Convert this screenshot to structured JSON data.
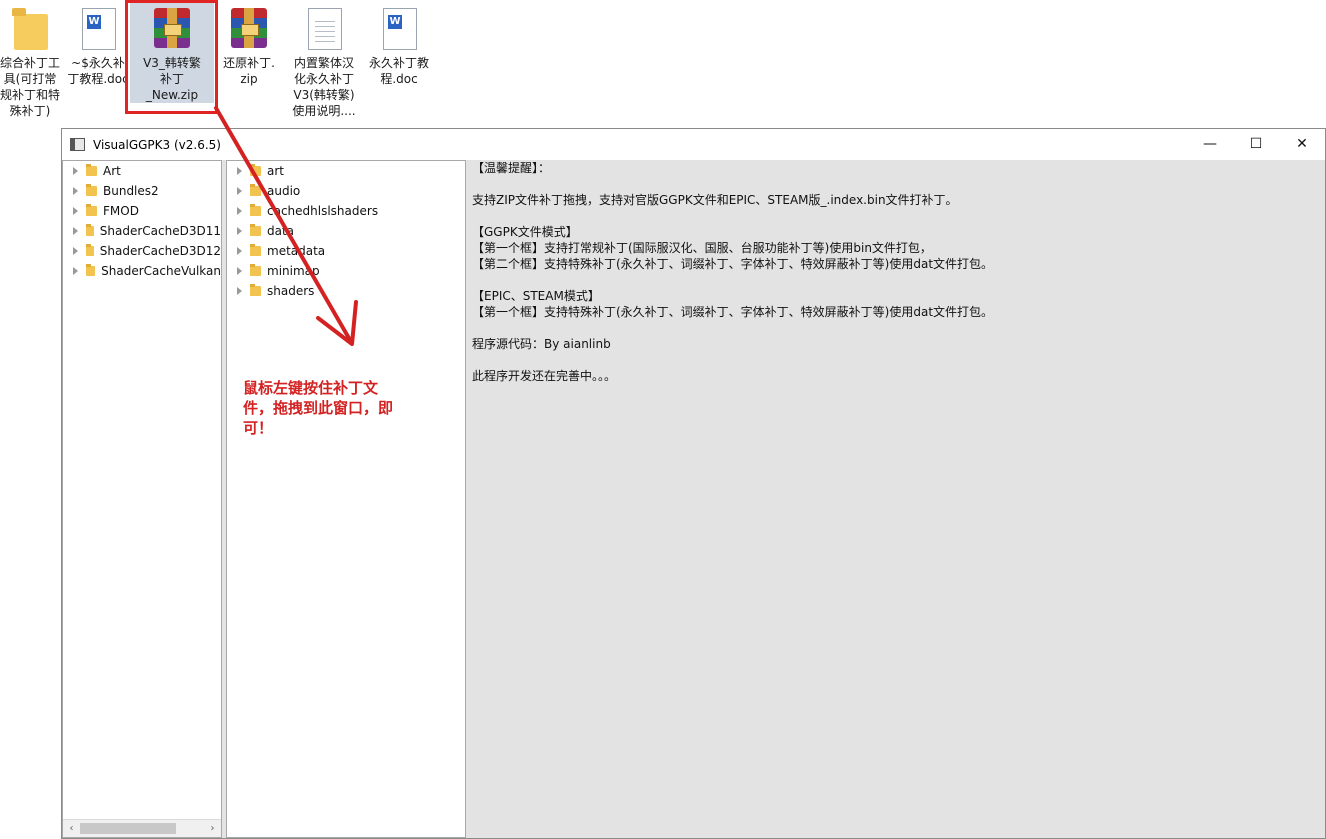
{
  "desktop": {
    "icons": [
      {
        "label": "综合补丁工\n具(可打常\n规补丁和特\n殊补丁)",
        "icon": "folder-icon"
      },
      {
        "label": "~$永久补\n丁教程.doc",
        "icon": "word-doc-icon"
      },
      {
        "label": "V3_韩转繁\n补丁\n_New.zip",
        "icon": "winrar-archive-icon",
        "selected": true
      },
      {
        "label": "还原补丁.\nzip",
        "icon": "winrar-archive-icon"
      },
      {
        "label": "内置繁体汉\n化永久补丁\nV3(韩转繁)\n使用说明....",
        "icon": "text-doc-icon"
      },
      {
        "label": "永久补丁教\n程.doc",
        "icon": "word-doc-icon"
      }
    ]
  },
  "window": {
    "title": "VisualGGPK3 (v2.6.5)",
    "controls": {
      "minimize": "—",
      "maximize": "☐",
      "close": "✕"
    }
  },
  "pane1": {
    "items": [
      "Art",
      "Bundles2",
      "FMOD",
      "ShaderCacheD3D11",
      "ShaderCacheD3D12",
      "ShaderCacheVulkan"
    ]
  },
  "pane2": {
    "items": [
      "art",
      "audio",
      "cachedhlslshaders",
      "data",
      "metadata",
      "minimap",
      "shaders"
    ]
  },
  "info": {
    "lines": [
      "【温馨提醒】：",
      "",
      "支持ZIP文件补丁拖拽，支持对官版GGPK文件和EPIC、STEAM版_.index.bin文件打补丁。",
      "",
      "【GGPK文件模式】",
      "【第一个框】支持打常规补丁(国际服汉化、国服、台服功能补丁等)使用bin文件打包，",
      "【第二个框】支持特殊补丁(永久补丁、词缀补丁、字体补丁、特效屏蔽补丁等)使用dat文件打包。",
      "",
      "【EPIC、STEAM模式】",
      "【第一个框】支持特殊补丁(永久补丁、词缀补丁、字体补丁、特效屏蔽补丁等)使用dat文件打包。",
      "",
      "程序源代码：By aianlinb",
      "",
      "此程序开发还在完善中。。。"
    ]
  },
  "annotation": {
    "text": "鼠标左键按住补丁文件，拖拽到此窗口，即可！",
    "color": "#d42222"
  },
  "scrollbar": {
    "left_arrow": "‹",
    "right_arrow": "›"
  }
}
